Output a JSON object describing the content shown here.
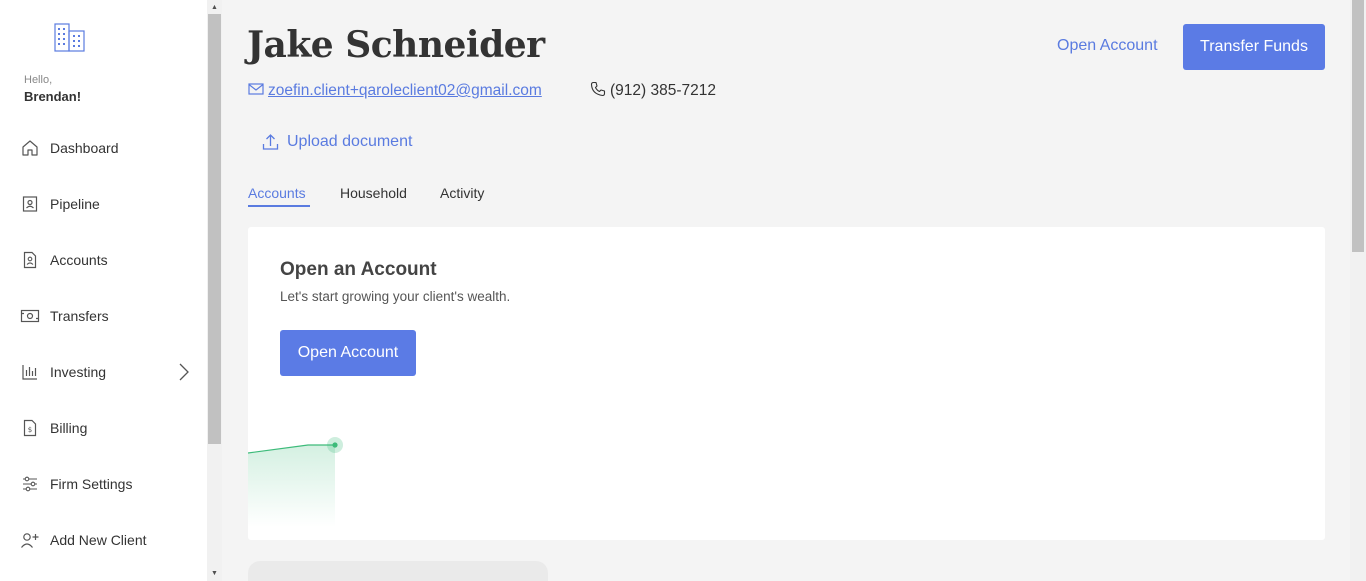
{
  "sidebar": {
    "greeting": "Hello,",
    "user_name": "Brendan!",
    "items": [
      {
        "label": "Dashboard",
        "icon": "home-icon"
      },
      {
        "label": "Pipeline",
        "icon": "pipeline-icon"
      },
      {
        "label": "Accounts",
        "icon": "accounts-icon"
      },
      {
        "label": "Transfers",
        "icon": "transfers-icon"
      },
      {
        "label": "Investing",
        "icon": "investing-icon"
      },
      {
        "label": "Billing",
        "icon": "billing-icon"
      },
      {
        "label": "Firm Settings",
        "icon": "sliders-icon"
      },
      {
        "label": "Add New Client",
        "icon": "add-user-icon"
      }
    ]
  },
  "header": {
    "client_name": "Jake Schneider",
    "open_account_link": "Open Account",
    "transfer_funds_button": "Transfer Funds",
    "email": "zoefin.client+qaroleclient02@gmail.com",
    "phone": "(912) 385-7212",
    "upload_label": "Upload document"
  },
  "tabs": [
    {
      "label": "Accounts",
      "active": true
    },
    {
      "label": "Household",
      "active": false
    },
    {
      "label": "Activity",
      "active": false
    }
  ],
  "card": {
    "title": "Open an Account",
    "subtitle": "Let's start growing your client's wealth.",
    "button": "Open Account"
  },
  "colors": {
    "accent": "#5b7be5",
    "chart_green": "#3dbb7a"
  }
}
